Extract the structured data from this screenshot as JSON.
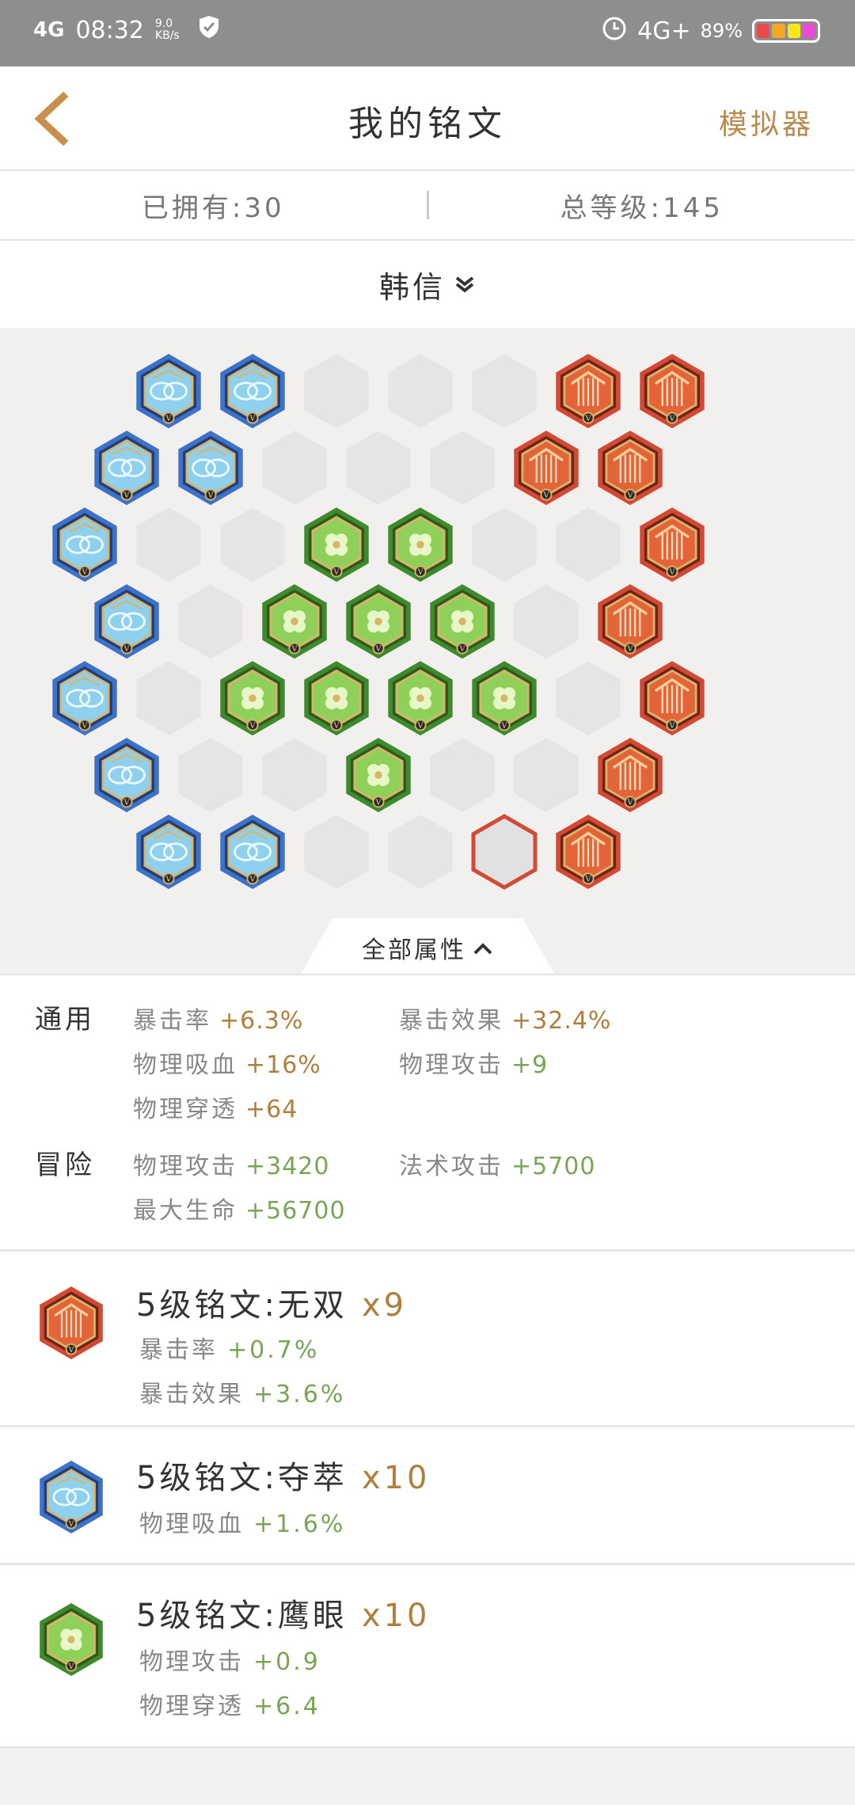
{
  "status_bar": {
    "network": "4G",
    "time": "08:32",
    "speed": "9.0 KB/s",
    "network_right": "4G+",
    "battery": "89%"
  },
  "nav": {
    "back_icon": "chevron-left-icon",
    "title": "我的铭文",
    "simulator_label": "模拟器"
  },
  "counts": {
    "owned": "已拥有:30",
    "total_level": "总等级:145"
  },
  "hero": {
    "name": "韩信",
    "chevron_icon": "double-chevron-down-icon"
  },
  "board": {
    "colors": {
      "blue": "#3d72c7",
      "green": "#3e8a2c",
      "red": "#d34a34"
    }
  },
  "all_attributes_tab": "全部属性",
  "attributes": {
    "general": {
      "label": "通用",
      "items": [
        {
          "name": "暴击率",
          "value": "+6.3%",
          "color": "#b07f3c"
        },
        {
          "name": "暴击效果",
          "value": "+32.4%",
          "color": "#b07f3c"
        },
        {
          "name": "物理吸血",
          "value": "+16%",
          "color": "#b07f3c"
        },
        {
          "name": "物理攻击",
          "value": "+9",
          "color": "#79a556"
        },
        {
          "name": "物理穿透",
          "value": "+64",
          "color": "#b07f3c"
        }
      ]
    },
    "adventure": {
      "label": "冒险",
      "items": [
        {
          "name": "物理攻击",
          "value": "+3420",
          "color": "#79a556"
        },
        {
          "name": "法术攻击",
          "value": "+5700",
          "color": "#79a556"
        },
        {
          "name": "最大生命",
          "value": "+56700",
          "color": "#79a556"
        }
      ]
    }
  },
  "runes": [
    {
      "name": "5级铭文:无双",
      "count": "x9",
      "type": "red",
      "icon": "red-rune-icon",
      "stats": [
        {
          "name": "暴击率",
          "value": "+0.7%"
        },
        {
          "name": "暴击效果",
          "value": "+3.6%"
        }
      ]
    },
    {
      "name": "5级铭文:夺萃",
      "count": "x10",
      "type": "blue",
      "icon": "blue-rune-icon",
      "stats": [
        {
          "name": "物理吸血",
          "value": "+1.6%"
        }
      ]
    },
    {
      "name": "5级铭文:鹰眼",
      "count": "x10",
      "type": "green",
      "icon": "green-rune-icon",
      "stats": [
        {
          "name": "物理攻击",
          "value": "+0.9"
        },
        {
          "name": "物理穿透",
          "value": "+6.4"
        }
      ]
    }
  ]
}
